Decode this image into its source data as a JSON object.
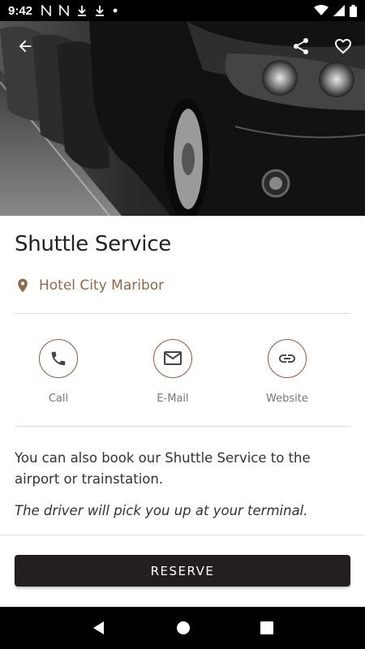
{
  "status_bar": {
    "time": "9:42",
    "notifications": [
      "N-icon",
      "N-icon",
      "download-icon",
      "download-icon",
      "dot-icon"
    ],
    "system": [
      "wifi-icon",
      "signal-icon",
      "battery-icon"
    ]
  },
  "hero": {
    "image_subject": "black car headlight",
    "icons": [
      "back-arrow-icon",
      "share-icon",
      "heart-icon"
    ]
  },
  "title": "Shuttle Service",
  "location": {
    "icon": "location-pin-icon",
    "label": "Hotel City Maribor"
  },
  "actions": [
    {
      "icon": "phone-icon",
      "label": "Call"
    },
    {
      "icon": "mail-icon",
      "label": "E-Mail"
    },
    {
      "icon": "link-icon",
      "label": "Website"
    }
  ],
  "description": "You can also book our Shuttle Service to the airport or trainstation.",
  "description_italic": "The driver will pick you up at your terminal.",
  "reserve_label": "RESERVE",
  "nav": [
    "back-triangle-icon",
    "home-circle-icon",
    "recents-square-icon"
  ],
  "colors": {
    "accent_brown": "#8a5a44",
    "location_text": "#8a6b4e",
    "button_bg": "#231f20"
  }
}
